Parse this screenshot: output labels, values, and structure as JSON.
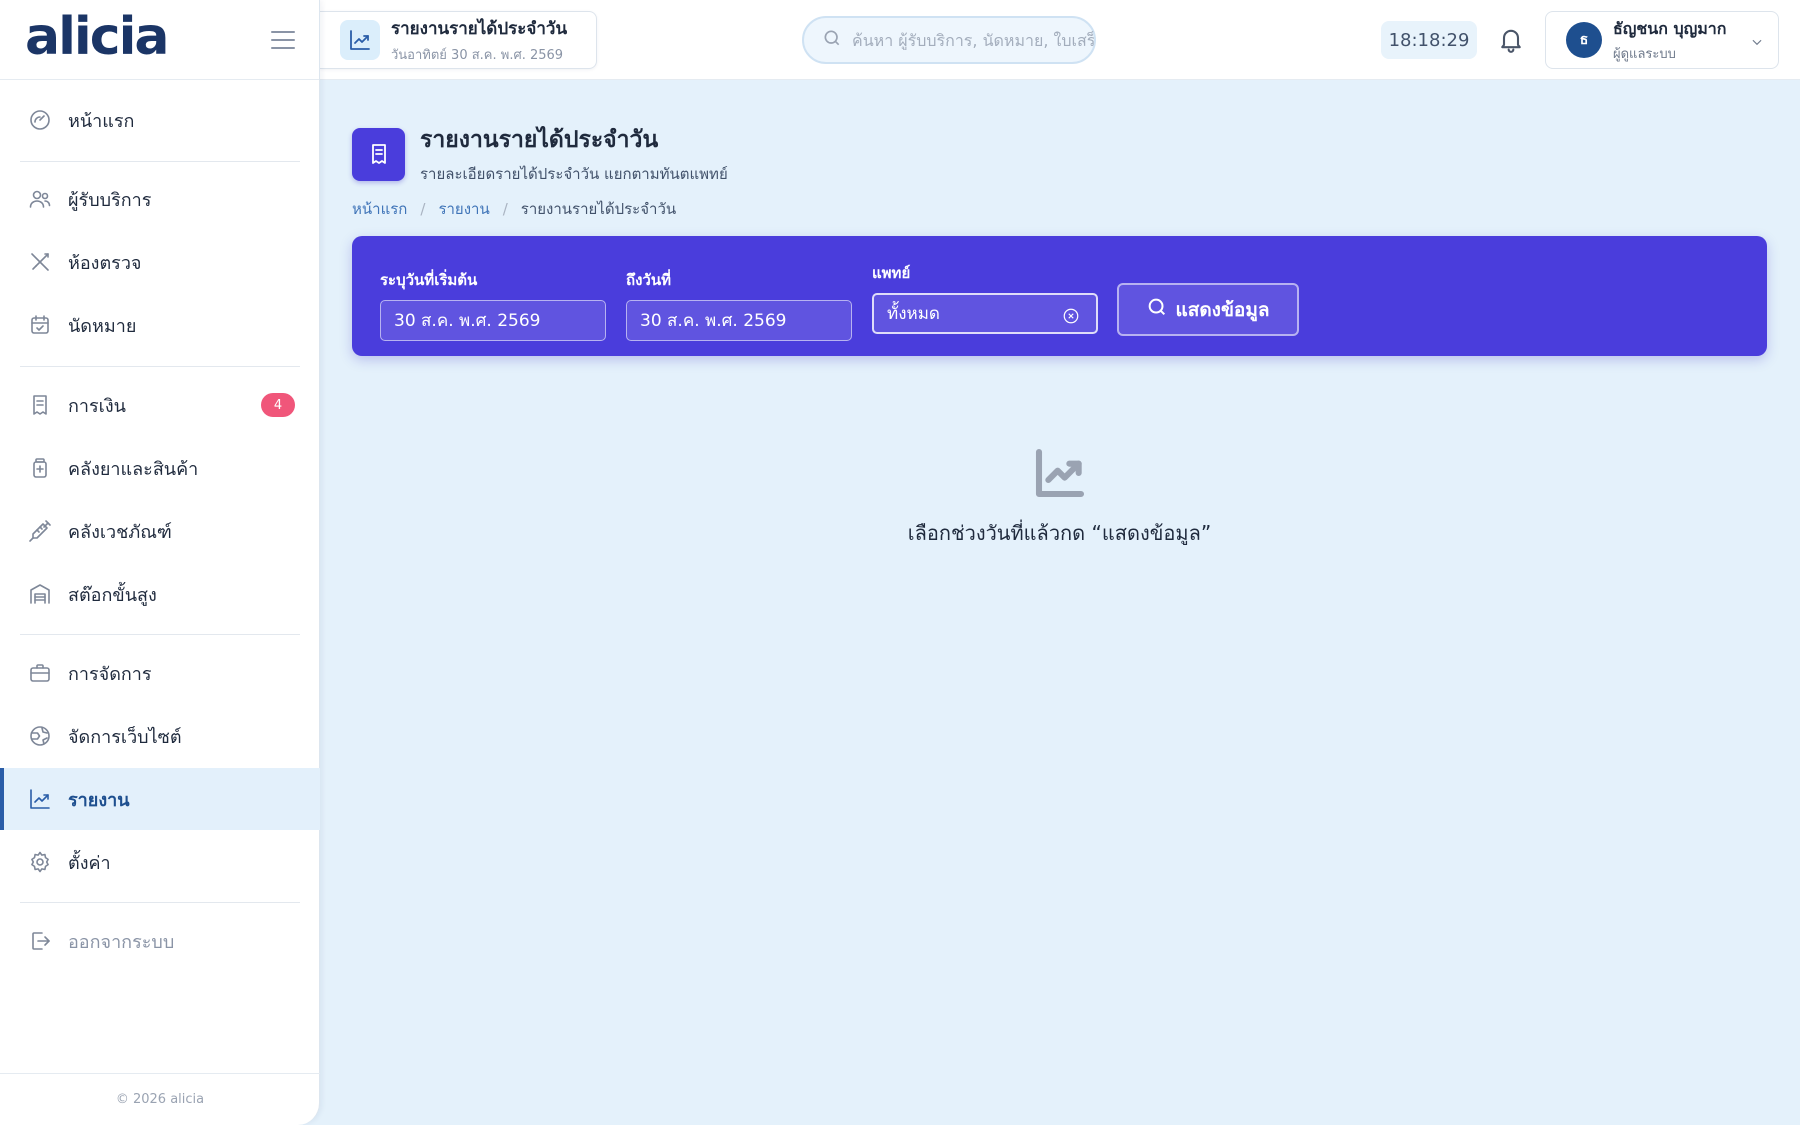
{
  "app": {
    "logo": "alicia",
    "footer": "© 2026 alicia"
  },
  "topbar": {
    "page_chip": {
      "title": "รายงานรายได้ประจำวัน",
      "subtitle": "วันอาทิตย์ 30 ส.ค. พ.ศ. 2569",
      "icon": "trend-chart-icon"
    },
    "search": {
      "placeholder": "ค้นหา ผู้รับบริการ, นัดหมาย, ใบเสร็จ...",
      "value": ""
    },
    "clock": "18:18:29",
    "user": {
      "initial": "ธ",
      "name": "ธัญชนก บุญมาก",
      "role": "ผู้ดูแลระบบ"
    }
  },
  "sidebar": {
    "items": [
      {
        "label": "หน้าแรก",
        "icon": "dashboard-gauge-icon"
      },
      {
        "label": "ผู้รับบริการ",
        "icon": "users-icon"
      },
      {
        "label": "ห้องตรวจ",
        "icon": "dental-tools-icon"
      },
      {
        "label": "นัดหมาย",
        "icon": "calendar-check-icon"
      },
      {
        "label": "การเงิน",
        "icon": "receipt-icon",
        "badge": "4"
      },
      {
        "label": "คลังยาและสินค้า",
        "icon": "medicine-bottle-icon"
      },
      {
        "label": "คลังเวชภัณฑ์",
        "icon": "syringe-icon"
      },
      {
        "label": "สต๊อกขั้นสูง",
        "icon": "warehouse-icon"
      },
      {
        "label": "การจัดการ",
        "icon": "briefcase-icon"
      },
      {
        "label": "จัดการเว็บไซต์",
        "icon": "globe-icon"
      },
      {
        "label": "รายงาน",
        "icon": "trend-chart-icon",
        "active": true
      },
      {
        "label": "ตั้งค่า",
        "icon": "gear-icon"
      },
      {
        "label": "ออกจากระบบ",
        "icon": "logout-icon"
      }
    ]
  },
  "main": {
    "title": "รายงานรายได้ประจำวัน",
    "subtitle": "รายละเอียดรายได้ประจำวัน แยกตามทันตแพทย์",
    "breadcrumb": [
      "หน้าแรก",
      "รายงาน",
      "รายงานรายได้ประจำวัน"
    ],
    "filters": {
      "start_label": "ระบุวันที่เริ่มต้น",
      "start_value": "30 ส.ค. พ.ศ. 2569",
      "end_label": "ถึงวันที่",
      "end_value": "30 ส.ค. พ.ศ. 2569",
      "doctor_label": "แพทย์",
      "doctor_value": "ทั้งหมด",
      "show_button": "แสดงข้อมูล"
    },
    "empty_text": "เลือกช่วงวันที่แล้วกด “แสดงข้อมูล”"
  },
  "colors": {
    "accent": "#4a3ddc",
    "brand": "#1b3566",
    "active_nav": "#2a5da8",
    "badge": "#f0567a",
    "background": "#e4f1fb"
  }
}
